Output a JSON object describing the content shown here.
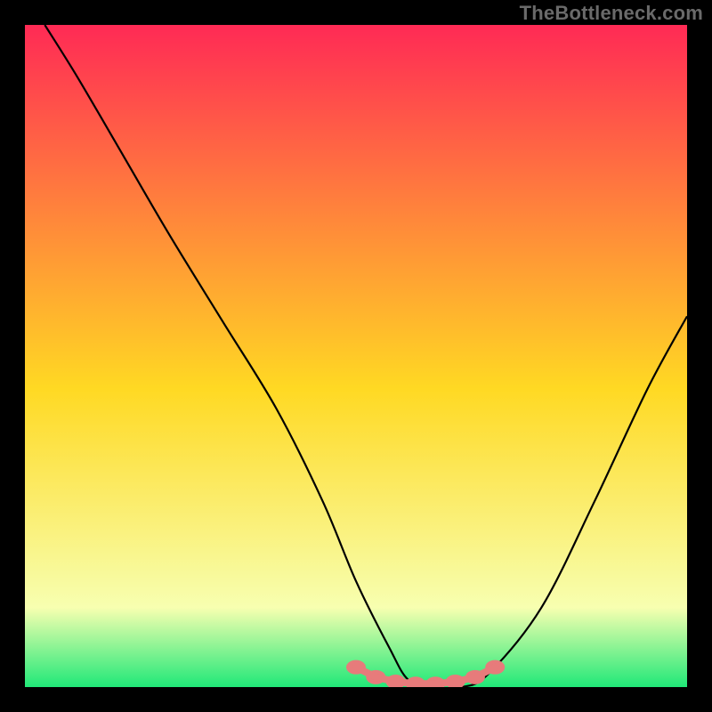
{
  "watermark": "TheBottleneck.com",
  "chart_data": {
    "type": "line",
    "title": "",
    "xlabel": "",
    "ylabel": "",
    "xlim": [
      0,
      100
    ],
    "ylim": [
      0,
      100
    ],
    "series": [
      {
        "name": "bottleneck-curve",
        "x": [
          3,
          8,
          15,
          22,
          30,
          38,
          45,
          50,
          55,
          58,
          62,
          66,
          70,
          78,
          86,
          94,
          100
        ],
        "values": [
          100,
          92,
          80,
          68,
          55,
          42,
          28,
          16,
          6,
          1,
          0,
          0,
          2,
          12,
          28,
          45,
          56
        ]
      }
    ],
    "markers": {
      "name": "highlight-segment",
      "x": [
        50,
        53,
        56,
        59,
        62,
        65,
        68,
        71
      ],
      "values": [
        3,
        1.5,
        0.8,
        0.5,
        0.5,
        0.8,
        1.5,
        3
      ],
      "color": "#e77b7b"
    },
    "background_gradient": {
      "top": "#ff2a55",
      "mid": "#ffd923",
      "low": "#f7ffb0",
      "bottom": "#20e878"
    },
    "frame_color": "#000000"
  }
}
